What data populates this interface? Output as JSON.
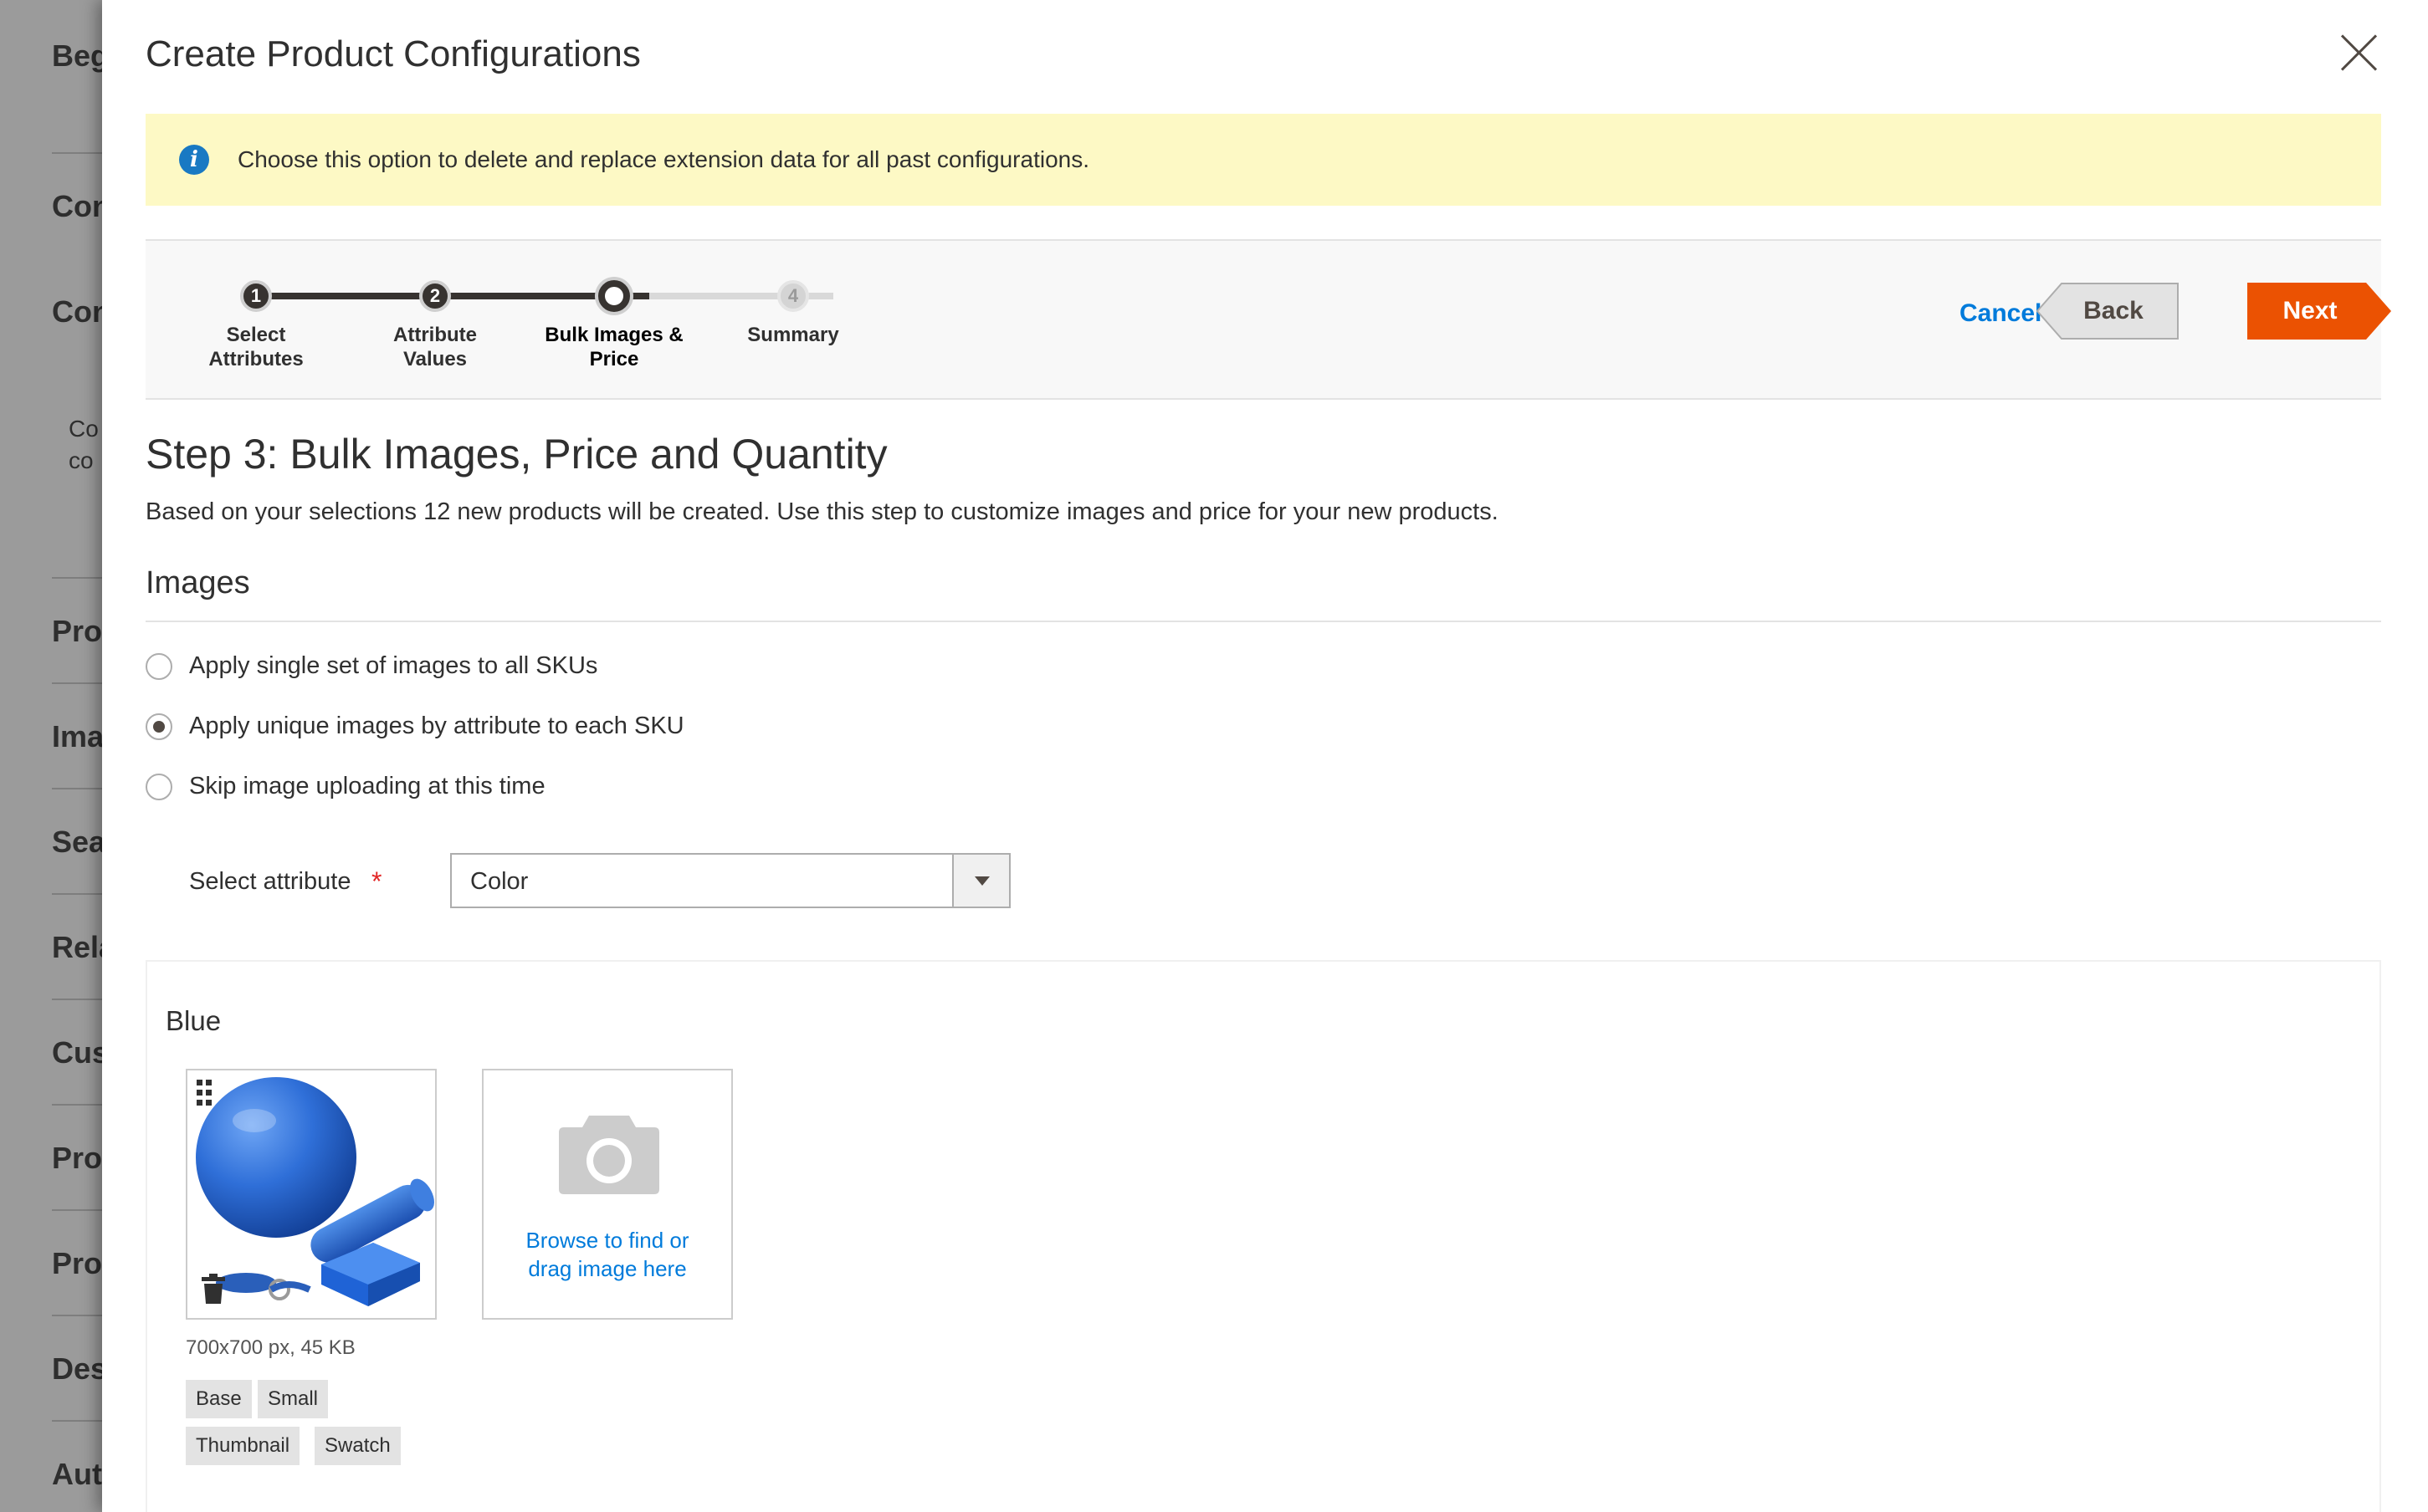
{
  "background_page": {
    "title_fragment": "Beg",
    "items": [
      "Con",
      "Con",
      "Pro",
      "Ima",
      "Sea",
      "Rela",
      "Cus",
      "Pro",
      "Pro",
      "Des",
      "Aut"
    ],
    "small_text": [
      "Co",
      "co"
    ]
  },
  "modal": {
    "title": "Create Product Configurations",
    "notice": "Choose this option to delete and replace extension data for all past configurations.",
    "info_icon_glyph": "i"
  },
  "wizard": {
    "steps": [
      {
        "number": "1",
        "label_line1": "Select",
        "label_line2": "Attributes",
        "state": "done"
      },
      {
        "number": "2",
        "label_line1": "Attribute",
        "label_line2": "Values",
        "state": "done"
      },
      {
        "number": "",
        "label_line1": "Bulk Images &",
        "label_line2": "Price",
        "state": "current"
      },
      {
        "number": "4",
        "label_line1": "Summary",
        "label_line2": "",
        "state": "future"
      }
    ],
    "cancel_label": "Cancel",
    "back_label": "Back",
    "next_label": "Next",
    "accent_color": "#eb5202"
  },
  "content": {
    "step_title": "Step 3: Bulk Images, Price and Quantity",
    "step_description": "Based on your selections 12 new products will be created. Use this step to customize images and price for your new products.",
    "images_section_title": "Images",
    "image_options": [
      {
        "label": "Apply single set of images to all SKUs",
        "checked": false
      },
      {
        "label": "Apply unique images by attribute to each SKU",
        "checked": true
      },
      {
        "label": "Skip image uploading at this time",
        "checked": false
      }
    ],
    "select_attribute_label": "Select attribute",
    "required_mark": "*",
    "selected_attribute": "Color"
  },
  "image_group": {
    "title": "Blue",
    "file_info": "700x700 px, 45 KB",
    "upload_text": "Browse to find or drag image here",
    "roles": [
      "Base",
      "Small",
      "Thumbnail",
      "Swatch"
    ]
  }
}
